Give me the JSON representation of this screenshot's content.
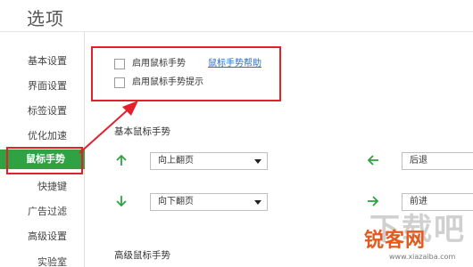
{
  "window": {
    "title": "选项"
  },
  "sidebar": {
    "items": [
      {
        "label": "基本设置"
      },
      {
        "label": "界面设置"
      },
      {
        "label": "标签设置"
      },
      {
        "label": "优化加速"
      },
      {
        "label": "鼠标手势",
        "active": true
      },
      {
        "label": "快捷键"
      },
      {
        "label": "广告过滤"
      },
      {
        "label": "高级设置"
      },
      {
        "label": "实验室"
      }
    ]
  },
  "gesture_options": {
    "enable_gesture_label": "启用鼠标手势",
    "help_link": "鼠标手势帮助",
    "enable_hint_label": "启用鼠标手势提示"
  },
  "basic_gestures": {
    "title": "基本鼠标手势",
    "rows": [
      {
        "direction_icon": "arrow-up-icon",
        "value": "向上翻页"
      },
      {
        "direction_icon": "arrow-left-icon",
        "value": "后退"
      },
      {
        "direction_icon": "arrow-down-icon",
        "value": "向下翻页"
      },
      {
        "direction_icon": "arrow-right-icon",
        "value": "前进"
      }
    ]
  },
  "advanced_gestures": {
    "title": "高级鼠标手势"
  },
  "watermark": {
    "text_main": "下载吧",
    "text_brand": "锐客网",
    "url": "www.xiazaiba.com"
  },
  "colors": {
    "accent_green": "#2fa243",
    "highlight_red": "#e3202c",
    "link_blue": "#2a6ec9"
  }
}
